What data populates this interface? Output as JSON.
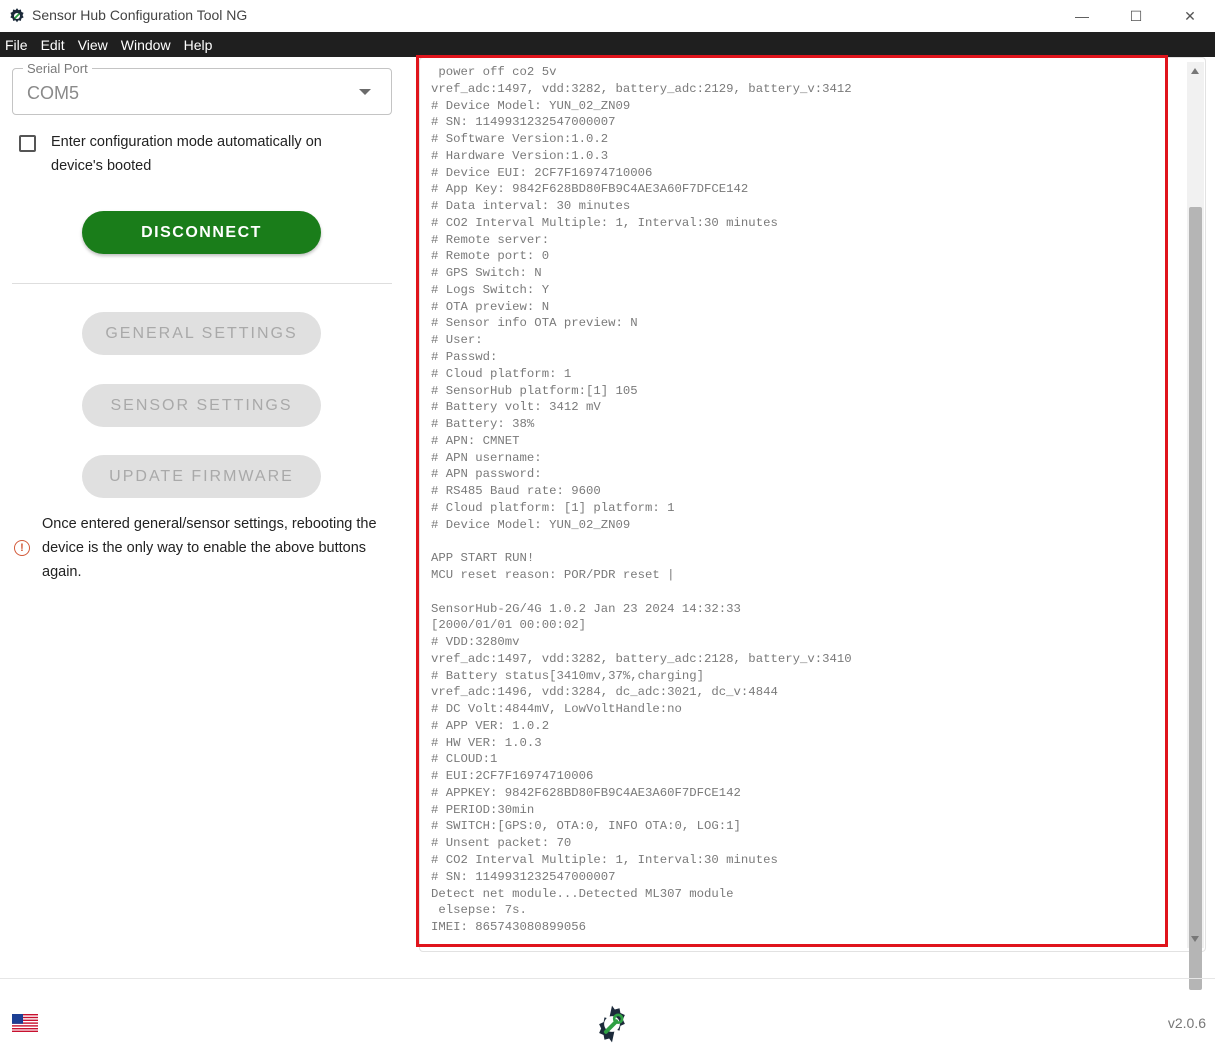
{
  "window": {
    "title": "Sensor Hub Configuration Tool NG",
    "controls": {
      "minimize": "—",
      "maximize": "☐",
      "close": "✕"
    }
  },
  "menu": [
    "File",
    "Edit",
    "View",
    "Window",
    "Help"
  ],
  "left_panel": {
    "serial_port": {
      "label": "Serial Port",
      "value": "COM5"
    },
    "auto_config": {
      "label": "Enter configuration mode automatically on device's booted",
      "checked": false
    },
    "disconnect_label": "DISCONNECT",
    "general_settings_label": "GENERAL SETTINGS",
    "sensor_settings_label": "SENSOR SETTINGS",
    "update_firmware_label": "UPDATE FIRMWARE",
    "info_text": "Once entered general/sensor settings, rebooting the device is the only way to enable the above buttons again."
  },
  "log_lines": [
    " power off co2 5v",
    "vref_adc:1497, vdd:3282, battery_adc:2129, battery_v:3412",
    "# Device Model: YUN_02_ZN09",
    "# SN: 1149931232547000007",
    "# Software Version:1.0.2",
    "# Hardware Version:1.0.3",
    "# Device EUI: 2CF7F16974710006",
    "# App Key: 9842F628BD80FB9C4AE3A60F7DFCE142",
    "# Data interval: 30 minutes",
    "# CO2 Interval Multiple: 1, Interval:30 minutes",
    "# Remote server:",
    "# Remote port: 0",
    "# GPS Switch: N",
    "# Logs Switch: Y",
    "# OTA preview: N",
    "# Sensor info OTA preview: N",
    "# User:",
    "# Passwd:",
    "# Cloud platform: 1",
    "# SensorHub platform:[1] 105",
    "# Battery volt: 3412 mV",
    "# Battery: 38%",
    "# APN: CMNET",
    "# APN username:",
    "# APN password:",
    "# RS485 Baud rate: 9600",
    "# Cloud platform: [1] platform: 1",
    "# Device Model: YUN_02_ZN09",
    "",
    "APP START RUN!",
    "MCU reset reason: POR/PDR reset |",
    "",
    "SensorHub-2G/4G 1.0.2 Jan 23 2024 14:32:33",
    "[2000/01/01 00:00:02]",
    "# VDD:3280mv",
    "vref_adc:1497, vdd:3282, battery_adc:2128, battery_v:3410",
    "# Battery status[3410mv,37%,charging]",
    "vref_adc:1496, vdd:3284, dc_adc:3021, dc_v:4844",
    "# DC Volt:4844mV, LowVoltHandle:no",
    "# APP VER: 1.0.2",
    "# HW VER: 1.0.3",
    "# CLOUD:1",
    "# EUI:2CF7F16974710006",
    "# APPKEY: 9842F628BD80FB9C4AE3A60F7DFCE142",
    "# PERIOD:30min",
    "# SWITCH:[GPS:0, OTA:0, INFO OTA:0, LOG:1]",
    "# Unsent packet: 70",
    "# CO2 Interval Multiple: 1, Interval:30 minutes",
    "# SN: 1149931232547000007",
    "Detect net module...Detected ML307 module",
    " elsepse: 7s.",
    "IMEI: 865743080899056"
  ],
  "footer": {
    "version": "v2.0.6"
  },
  "colors": {
    "disconnect_bg": "#1a7d1a",
    "highlight_border": "#e0141c",
    "menubar_bg": "#1f1f1f",
    "logo_green": "#2ea043",
    "logo_gear": "#1c2a3a"
  },
  "icons": {
    "app": "gear-icon",
    "info": "info-circle-icon",
    "flag": "us-flag-icon",
    "logo": "gear-wrench-logo-icon"
  }
}
